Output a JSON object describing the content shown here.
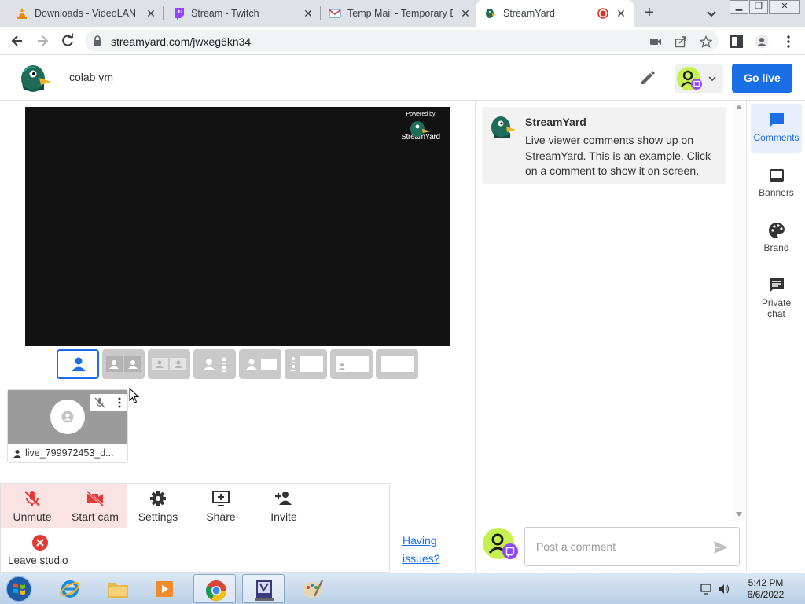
{
  "browser": {
    "tabs": [
      {
        "title": "Downloads - VideoLAN",
        "icon": "vlc-cone-icon"
      },
      {
        "title": "Stream - Twitch",
        "icon": "twitch-icon"
      },
      {
        "title": "Temp Mail - Temporary E",
        "icon": "mail-icon"
      },
      {
        "title": "StreamYard",
        "icon": "streamyard-duck-icon",
        "active": true,
        "recording": true
      }
    ],
    "url": "streamyard.com/jwxeg6kn34"
  },
  "header": {
    "studio_name": "colab vm",
    "go_live_label": "Go live"
  },
  "stage": {
    "powered_by": "Powered by",
    "brand": "StreamYard"
  },
  "guest": {
    "name": "live_799972453_d..."
  },
  "controls": {
    "unmute": "Unmute",
    "start_cam": "Start cam",
    "settings": "Settings",
    "share": "Share",
    "invite": "Invite",
    "leave": "Leave studio",
    "issues_line1": "Having",
    "issues_line2": "issues?"
  },
  "comments": {
    "sample_author": "StreamYard",
    "sample_text": "Live viewer comments show up on StreamYard. This is an example. Click on a comment to show it on screen.",
    "post_placeholder": "Post a comment"
  },
  "rail": {
    "comments": "Comments",
    "banners": "Banners",
    "brand": "Brand",
    "private_chat_1": "Private",
    "private_chat_2": "chat"
  },
  "taskbar": {
    "time": "5:42 PM",
    "date": "6/6/2022"
  },
  "colors": {
    "accent": "#1a6fe6",
    "warn_bg": "#fbe3e3",
    "danger": "#e53935",
    "avatar_green": "#c6f24e",
    "twitch_purple": "#9146ff"
  }
}
